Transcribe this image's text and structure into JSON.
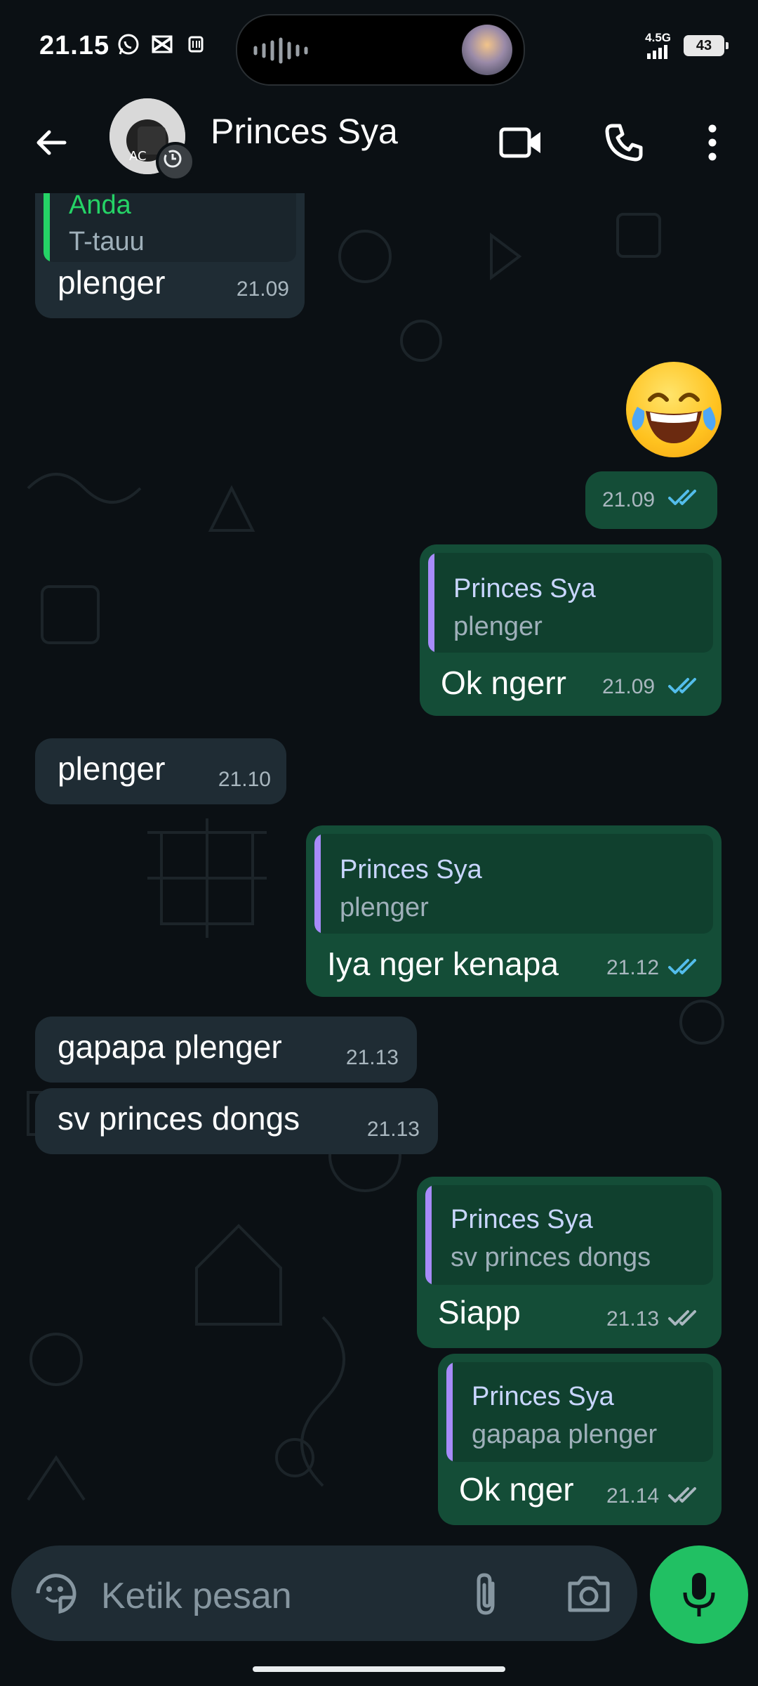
{
  "status_bar": {
    "time": "21.15",
    "network": "4.5G",
    "battery": "43"
  },
  "header": {
    "contact_name": "Princes Sya"
  },
  "messages": [
    {
      "dir": "in",
      "quote": {
        "name": "Anda",
        "text": "T-tauu"
      },
      "text": "plenger",
      "time": "21.09"
    },
    {
      "dir": "out",
      "emoji": "laughing-with-tears",
      "time": "21.09",
      "status": "read"
    },
    {
      "dir": "out",
      "quote": {
        "name": "Princes Sya",
        "text": "plenger"
      },
      "text": "Ok ngerr",
      "time": "21.09",
      "status": "read"
    },
    {
      "dir": "in",
      "text": "plenger",
      "time": "21.10"
    },
    {
      "dir": "out",
      "quote": {
        "name": "Princes Sya",
        "text": "plenger"
      },
      "text": "Iya nger kenapa",
      "time": "21.12",
      "status": "read"
    },
    {
      "dir": "in",
      "text": "gapapa plenger",
      "time": "21.13"
    },
    {
      "dir": "in",
      "text": "sv princes dongs",
      "time": "21.13"
    },
    {
      "dir": "out",
      "quote": {
        "name": "Princes Sya",
        "text": "sv princes dongs"
      },
      "text": "Siapp",
      "time": "21.13",
      "status": "delivered"
    },
    {
      "dir": "out",
      "quote": {
        "name": "Princes Sya",
        "text": "gapapa plenger"
      },
      "text": "Ok nger",
      "time": "21.14",
      "status": "delivered"
    }
  ],
  "input": {
    "placeholder": "Ketik pesan"
  },
  "colors": {
    "accent_green": "#21c063",
    "incoming_bubble": "#1f2c34",
    "outgoing_bubble": "#144d37",
    "quote_self": "#25d366",
    "quote_contact": "#a78bfa",
    "read_tick": "#53bdeb",
    "delivered_tick": "#a9b7bf"
  }
}
